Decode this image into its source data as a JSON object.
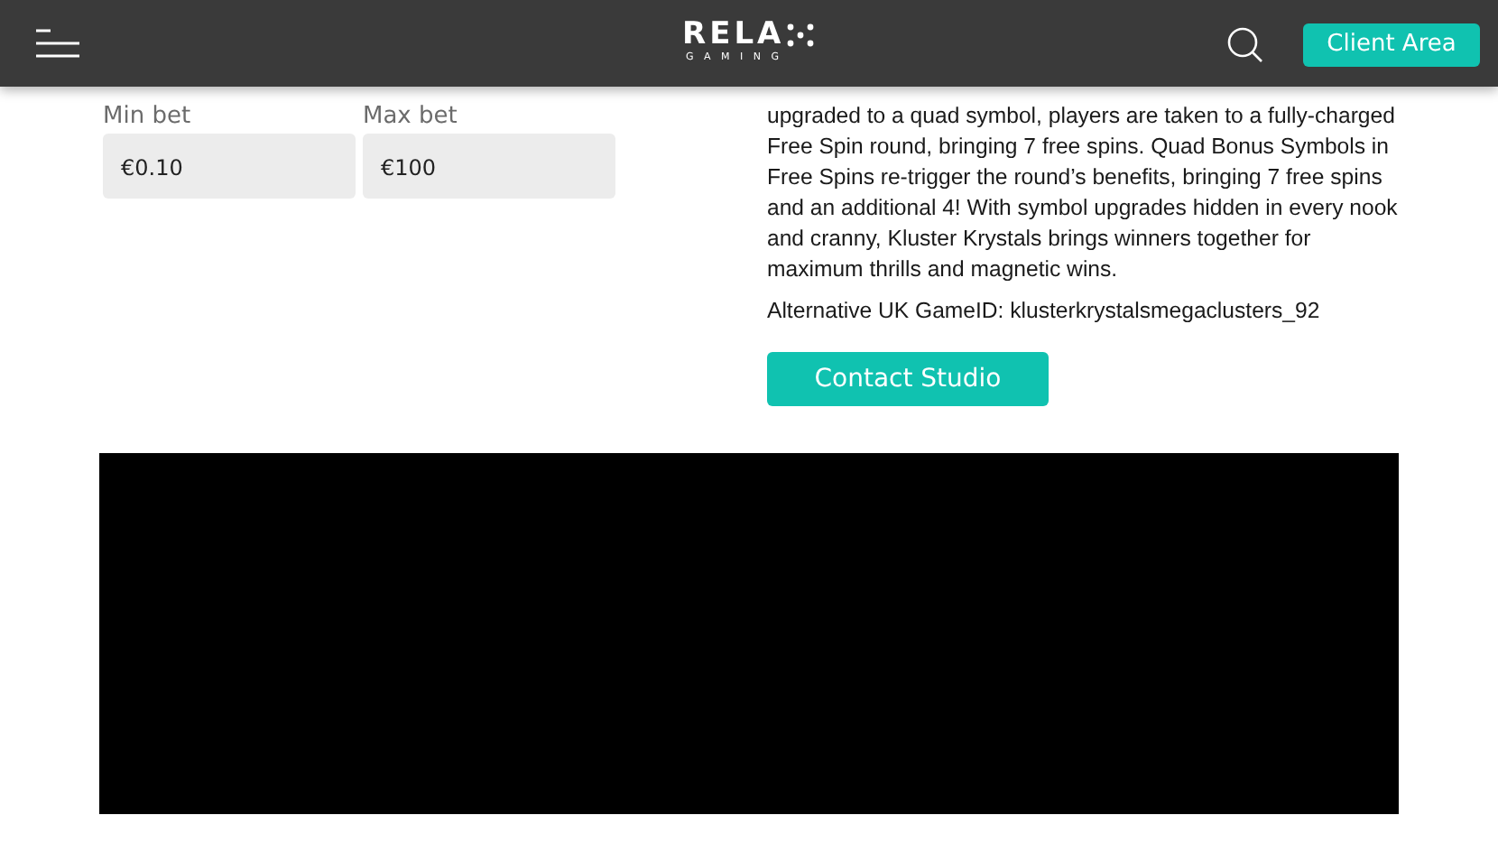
{
  "header": {
    "logo": {
      "word": "RELA",
      "tagline": "G A M I N G"
    },
    "client_button": "Client Area"
  },
  "bets": [
    {
      "label": "Min bet",
      "value": "€0.10"
    },
    {
      "label": "Max bet",
      "value": "€100"
    }
  ],
  "description": "upgraded to a quad symbol, players are taken to a fully-charged Free Spin round, bringing 7 free spins. Quad Bonus Symbols in Free Spins re-trigger the round’s benefits, bringing 7 free spins and an additional 4! With symbol upgrades hidden in every nook and cranny, Kluster Krystals brings winners together for maximum thrills and magnetic wins.",
  "alt_game_id": "Alternative UK GameID: klusterkrystalsmegaclusters_92",
  "contact_button": "Contact Studio"
}
